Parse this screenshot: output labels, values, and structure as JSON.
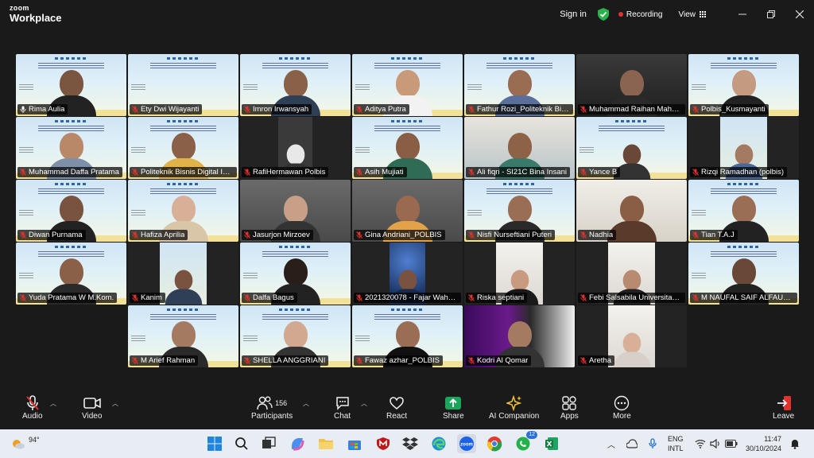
{
  "app": {
    "brand_top": "zoom",
    "brand_bottom": "Workplace"
  },
  "titlebar": {
    "sign_in": "Sign in",
    "recording": "Recording",
    "view": "View"
  },
  "participants": [
    {
      "name": "Rima Aulia",
      "muted": false,
      "active": true,
      "bg": "slide-person",
      "skin": "#7a5540",
      "shirt": "#222"
    },
    {
      "name": "Ety Dwi Wijayanti",
      "muted": true,
      "bg": "slide",
      "skin": "",
      "shirt": ""
    },
    {
      "name": "Imron Irwansyah",
      "muted": true,
      "bg": "slide-person",
      "skin": "#8a6048",
      "shirt": "#2f3f55"
    },
    {
      "name": "Aditya Putra",
      "muted": true,
      "bg": "slide-person",
      "skin": "#c89a7a",
      "shirt": "#f2f2f2"
    },
    {
      "name": "Fathur Rozi_Politeknik Bisnis Di...",
      "muted": true,
      "bg": "slide-person",
      "skin": "#9a6d52",
      "shirt": "#5a6f9a"
    },
    {
      "name": "Muhammad Raihan Mahard...",
      "muted": true,
      "bg": "cam-dark",
      "skin": "#8a6450",
      "shirt": "#2a2a2a"
    },
    {
      "name": "Polbis_Kusmayanti",
      "muted": true,
      "bg": "slide-person",
      "skin": "#c49a80",
      "shirt": "#222"
    },
    {
      "name": "Muhammad Daffa Pratama",
      "muted": true,
      "bg": "slide-person",
      "skin": "#b88868",
      "shirt": "#7e8fa8"
    },
    {
      "name": "Politeknik Bisnis Digital Ind...",
      "muted": true,
      "bg": "slide-person",
      "skin": "#8a6048",
      "shirt": "#e0b24a"
    },
    {
      "name": "RafiHermawan Polbis",
      "muted": true,
      "bg": "dark-dog",
      "skin": "#e8e8e8",
      "shirt": "#333"
    },
    {
      "name": "Asih Mujiati",
      "muted": true,
      "bg": "slide-person",
      "skin": "#8a5e45",
      "shirt": "#2f6b55"
    },
    {
      "name": "Ali fiqri - SI21C Bina Insani",
      "muted": true,
      "bg": "cam-room",
      "skin": "#8e6247",
      "shirt": "#3a7a6a"
    },
    {
      "name": "Yance B",
      "muted": true,
      "bg": "slide-small",
      "skin": "#6a4838",
      "shirt": "#333"
    },
    {
      "name": "Rizqi Ramadhan (polbis)",
      "muted": true,
      "bg": "dark-small",
      "skin": "#a47a60",
      "shirt": "#4a6a9a"
    },
    {
      "name": "Diwan Purnama",
      "muted": true,
      "bg": "slide-person",
      "skin": "#7a5240",
      "shirt": "#222"
    },
    {
      "name": "Hafiza Aprilia",
      "muted": true,
      "bg": "slide-person",
      "skin": "#d8b098",
      "shirt": "#d9c6a8"
    },
    {
      "name": "Jasurjon Mirzoev",
      "muted": true,
      "bg": "cam-gray",
      "skin": "#c8a088",
      "shirt": "#333"
    },
    {
      "name": "Gina Andriani_POLBIS",
      "muted": true,
      "bg": "cam-gray",
      "skin": "#9a6a50",
      "shirt": "#e2a24a"
    },
    {
      "name": "Nisfi Nurseftiani Puteri",
      "muted": true,
      "bg": "slide-person",
      "skin": "#9a6e55",
      "shirt": "#2a2a2a"
    },
    {
      "name": "Nadhia",
      "muted": true,
      "bg": "cam-light",
      "skin": "#8a5e45",
      "shirt": "#5a3a2a"
    },
    {
      "name": "Tian T.A.J",
      "muted": true,
      "bg": "slide-person",
      "skin": "#9a6e55",
      "shirt": "#222"
    },
    {
      "name": "Yuda Pratama W M.Kom.",
      "muted": true,
      "bg": "slide-person",
      "skin": "#8a6048",
      "shirt": "#2a2a2a"
    },
    {
      "name": "Kanim",
      "muted": true,
      "bg": "dark-small",
      "skin": "#7a5240",
      "shirt": "#2f3f55"
    },
    {
      "name": "Dalfa Bagus",
      "muted": true,
      "bg": "slide-person",
      "skin": "#2a1e1a",
      "shirt": "#222"
    },
    {
      "name": "2021320078 - Fajar Wahyu...",
      "muted": true,
      "bg": "dark-space",
      "skin": "#7a5240",
      "shirt": "#1a2a4a"
    },
    {
      "name": "Riska septiani",
      "muted": true,
      "bg": "dark-light",
      "skin": "#c89a80",
      "shirt": "#1a1a1a"
    },
    {
      "name": "Febi Salsabila Universitas B...",
      "muted": true,
      "bg": "dark-light",
      "skin": "#b88a70",
      "shirt": "#222"
    },
    {
      "name": "M NAUFAL SAIF ALFAUZAN...",
      "muted": true,
      "bg": "slide-person",
      "skin": "#6a4838",
      "shirt": "#222"
    },
    {
      "name": "M Arief Rahman",
      "muted": true,
      "bg": "slide-person",
      "skin": "#a47a60",
      "shirt": "#2a2a2a"
    },
    {
      "name": "SHELLA ANGGRIANI",
      "muted": true,
      "bg": "slide-person",
      "skin": "#d2a890",
      "shirt": "#333"
    },
    {
      "name": "Fawaz azhar_POLBIS",
      "muted": true,
      "bg": "slide-person",
      "skin": "#9a6e55",
      "shirt": "#111"
    },
    {
      "name": "Kodri Al Qomar",
      "muted": true,
      "bg": "dark-purple",
      "skin": "#a47a60",
      "shirt": "#333"
    },
    {
      "name": "Aretha",
      "muted": true,
      "bg": "dark-light",
      "skin": "#d8b098",
      "shirt": "#d8d0c8"
    }
  ],
  "toolbar": {
    "audio": "Audio",
    "video": "Video",
    "participants": "Participants",
    "participants_count": "156",
    "chat": "Chat",
    "react": "React",
    "share": "Share",
    "ai": "AI Companion",
    "apps": "Apps",
    "more": "More",
    "leave": "Leave"
  },
  "taskbar": {
    "weather": "94°",
    "lang1": "ENG",
    "lang2": "INTL",
    "time": "11:47",
    "date": "30/10/2024",
    "whatsapp_badge": "12"
  }
}
